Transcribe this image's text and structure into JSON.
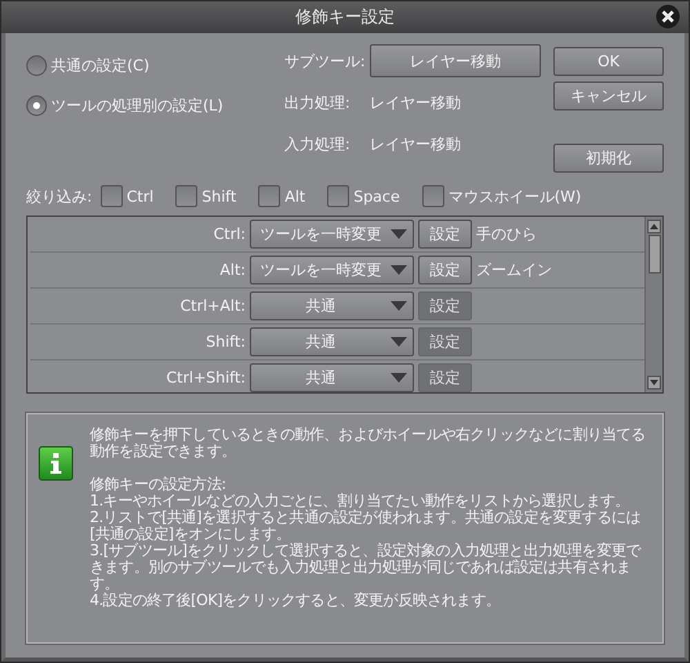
{
  "window": {
    "title": "修飾キー設定"
  },
  "modes": [
    {
      "label": "共通の設定(C)",
      "selected": false
    },
    {
      "label": "ツールの処理別の設定(L)",
      "selected": true
    }
  ],
  "subtool": {
    "label": "サブツール:",
    "value": "レイヤー移動"
  },
  "output": {
    "label": "出力処理:",
    "value": "レイヤー移動"
  },
  "input": {
    "label": "入力処理:",
    "value": "レイヤー移動"
  },
  "buttons": {
    "ok": "OK",
    "cancel": "キャンセル",
    "reset": "初期化"
  },
  "filter": {
    "label": "絞り込み:",
    "options": [
      {
        "label": "Ctrl",
        "checked": false
      },
      {
        "label": "Shift",
        "checked": false
      },
      {
        "label": "Alt",
        "checked": false
      },
      {
        "label": "Space",
        "checked": false
      },
      {
        "label": "マウスホイール(W)",
        "checked": false
      }
    ]
  },
  "rows": [
    {
      "key": "Ctrl:",
      "action": "ツールを一時変更",
      "set": "設定",
      "disabled": false,
      "result": "手のひら"
    },
    {
      "key": "Alt:",
      "action": "ツールを一時変更",
      "set": "設定",
      "disabled": false,
      "result": "ズームイン"
    },
    {
      "key": "Ctrl+Alt:",
      "action": "共通",
      "set": "設定",
      "disabled": true
    },
    {
      "key": "Shift:",
      "action": "共通",
      "set": "設定",
      "disabled": true
    },
    {
      "key": "Ctrl+Shift:",
      "action": "共通",
      "set": "設定",
      "disabled": true
    }
  ],
  "help": {
    "intro": "修飾キーを押下しているときの動作、およびホイールや右クリックなどに割り当てる動作を設定できます。",
    "heading": "修飾キーの設定方法:",
    "steps": [
      "1.キーやホイールなどの入力ごとに、割り当てたい動作をリストから選択します。",
      "2.リストで[共通]を選択すると共通の設定が使われます。共通の設定を変更するには[共通の設定]をオンにします。",
      "3.[サブツール]をクリックして選択すると、設定対象の入力処理と出力処理を変更できます。別のサブツールでも入力処理と出力処理が同じであれば設定は共有されます。",
      "4.設定の終了後[OK]をクリックすると、変更が反映されます。"
    ]
  }
}
